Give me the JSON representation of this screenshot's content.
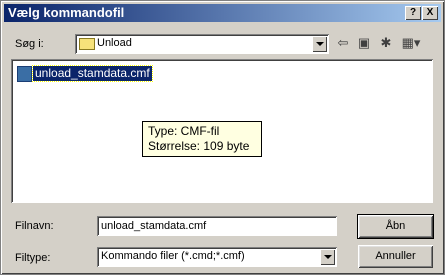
{
  "window": {
    "title": "Vælg kommandofil",
    "help_label": "?",
    "close_label": "X"
  },
  "toolbar": {
    "look_in_label": "Søg i:",
    "look_in_value": "Unload",
    "back_icon": "arrow-left-icon",
    "up_icon": "up-folder-icon",
    "new_folder_icon": "new-folder-icon",
    "view_menu_icon": "view-menu-icon"
  },
  "files": [
    {
      "name": "unload_stamdata.cmf",
      "selected": true
    }
  ],
  "tooltip": {
    "line1": "Type: CMF-fil",
    "line2": "Størrelse: 109 byte"
  },
  "form": {
    "filename_label": "Filnavn:",
    "filename_value": "unload_stamdata.cmf",
    "filetype_label": "Filtype:",
    "filetype_value": "Kommando filer (*.cmd;*.cmf)"
  },
  "buttons": {
    "open_label": "Åbn",
    "cancel_label": "Annuller"
  }
}
